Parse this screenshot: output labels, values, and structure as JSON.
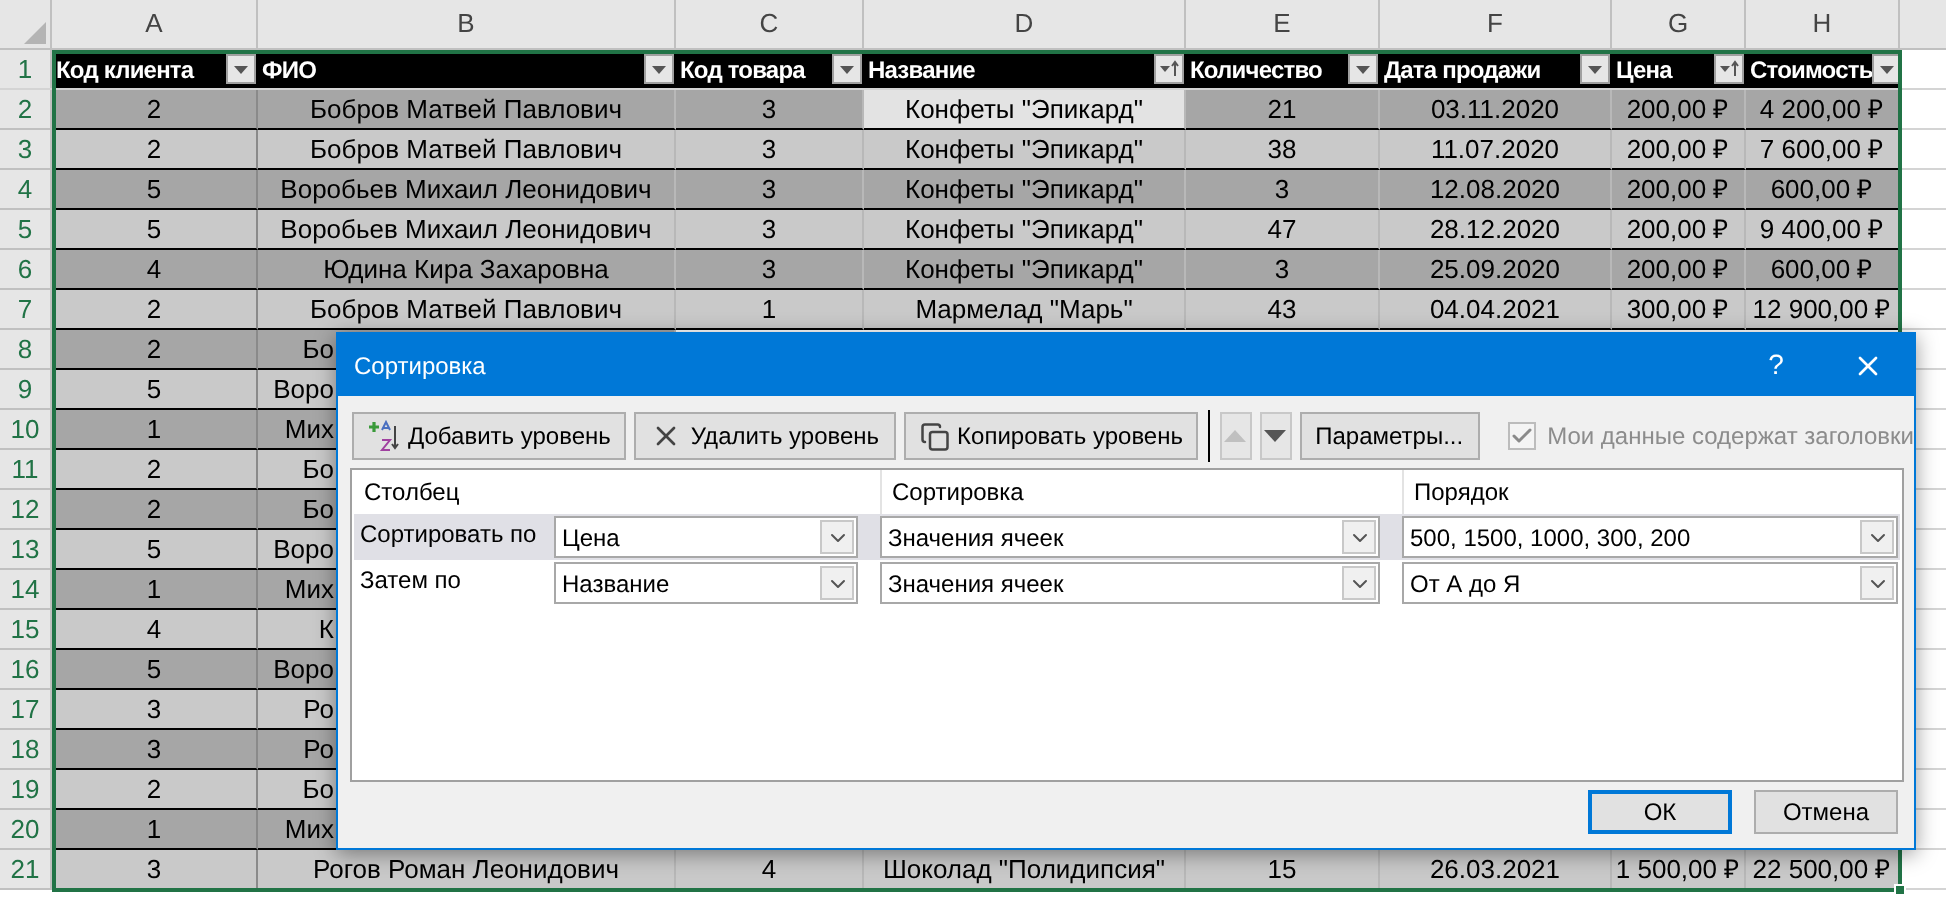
{
  "sheet": {
    "columns": [
      {
        "letter": "A",
        "header": "Код клиента",
        "sorted": false
      },
      {
        "letter": "B",
        "header": "ФИО",
        "sorted": false
      },
      {
        "letter": "C",
        "header": "Код товара",
        "sorted": false
      },
      {
        "letter": "D",
        "header": "Название",
        "sorted": true
      },
      {
        "letter": "E",
        "header": "Количество",
        "sorted": false
      },
      {
        "letter": "F",
        "header": "Дата продажи",
        "sorted": false
      },
      {
        "letter": "G",
        "header": "Цена",
        "sorted": true
      },
      {
        "letter": "H",
        "header": "Стоимость",
        "sorted": false
      }
    ],
    "header_row_number": "1",
    "rows": [
      {
        "number": "2",
        "cells": [
          "2",
          "Бобров Матвей Павлович",
          "3",
          "Конфеты \"Эпикард\"",
          "21",
          "03.11.2020",
          "200,00 ₽",
          "4 200,00 ₽"
        ],
        "selected_cells": [
          false,
          false,
          false,
          true,
          false,
          false,
          false,
          false
        ]
      },
      {
        "number": "3",
        "cells": [
          "2",
          "Бобров Матвей Павлович",
          "3",
          "Конфеты \"Эпикард\"",
          "38",
          "11.07.2020",
          "200,00 ₽",
          "7 600,00 ₽"
        ],
        "selected_cells": [
          false,
          false,
          false,
          false,
          false,
          false,
          false,
          false
        ]
      },
      {
        "number": "4",
        "cells": [
          "5",
          "Воробьев Михаил Леонидович",
          "3",
          "Конфеты \"Эпикард\"",
          "3",
          "12.08.2020",
          "200,00 ₽",
          "600,00 ₽"
        ],
        "selected_cells": [
          false,
          false,
          false,
          false,
          false,
          false,
          false,
          false
        ]
      },
      {
        "number": "5",
        "cells": [
          "5",
          "Воробьев Михаил Леонидович",
          "3",
          "Конфеты \"Эпикард\"",
          "47",
          "28.12.2020",
          "200,00 ₽",
          "9 400,00 ₽"
        ],
        "selected_cells": [
          false,
          false,
          false,
          false,
          false,
          false,
          false,
          false
        ]
      },
      {
        "number": "6",
        "cells": [
          "4",
          "Юдина Кира Захаровна",
          "3",
          "Конфеты \"Эпикард\"",
          "3",
          "25.09.2020",
          "200,00 ₽",
          "600,00 ₽"
        ],
        "selected_cells": [
          false,
          false,
          false,
          false,
          false,
          false,
          false,
          false
        ]
      },
      {
        "number": "7",
        "cells": [
          "2",
          "Бобров Матвей Павлович",
          "1",
          "Мармелад \"Марь\"",
          "43",
          "04.04.2021",
          "300,00 ₽",
          "12 900,00 ₽"
        ],
        "selected_cells": [
          false,
          false,
          false,
          false,
          false,
          false,
          false,
          false
        ]
      },
      {
        "number": "8",
        "cells": [
          "2",
          "Бо"
        ],
        "selected_cells": [
          false,
          false
        ]
      },
      {
        "number": "9",
        "cells": [
          "5",
          "Воро"
        ],
        "selected_cells": [
          false,
          false
        ]
      },
      {
        "number": "10",
        "cells": [
          "1",
          "Мих"
        ],
        "selected_cells": [
          false,
          false
        ]
      },
      {
        "number": "11",
        "cells": [
          "2",
          "Бо"
        ],
        "selected_cells": [
          false,
          false
        ]
      },
      {
        "number": "12",
        "cells": [
          "2",
          "Бо"
        ],
        "selected_cells": [
          false,
          false
        ]
      },
      {
        "number": "13",
        "cells": [
          "5",
          "Воро"
        ],
        "selected_cells": [
          false,
          false
        ]
      },
      {
        "number": "14",
        "cells": [
          "1",
          "Мих"
        ],
        "selected_cells": [
          false,
          false
        ]
      },
      {
        "number": "15",
        "cells": [
          "4",
          "К"
        ],
        "selected_cells": [
          false,
          false
        ]
      },
      {
        "number": "16",
        "cells": [
          "5",
          "Воро"
        ],
        "selected_cells": [
          false,
          false
        ]
      },
      {
        "number": "17",
        "cells": [
          "3",
          "Ро"
        ],
        "selected_cells": [
          false,
          false
        ]
      },
      {
        "number": "18",
        "cells": [
          "3",
          "Ро"
        ],
        "selected_cells": [
          false,
          false
        ]
      },
      {
        "number": "19",
        "cells": [
          "2",
          "Бо"
        ],
        "selected_cells": [
          false,
          false
        ]
      },
      {
        "number": "20",
        "cells": [
          "1",
          "Мих"
        ],
        "selected_cells": [
          false,
          false
        ]
      },
      {
        "number": "21",
        "cells": [
          "3",
          "Рогов Роман Леонидович",
          "4",
          "Шоколад \"Полидипсия\"",
          "15",
          "26.03.2021",
          "1 500,00 ₽",
          "22 500,00 ₽"
        ],
        "selected_cells": [
          false,
          false,
          false,
          false,
          false,
          false,
          false,
          false
        ]
      }
    ]
  },
  "dialog": {
    "title": "Сортировка",
    "help": "?",
    "toolbar": [
      {
        "kind": "add",
        "label": "Добавить уровень",
        "disabled": false
      },
      {
        "kind": "delete",
        "label": "Удалить уровень",
        "disabled": false
      },
      {
        "kind": "copy",
        "label": "Копировать уровень",
        "disabled": false
      },
      {
        "kind": "up",
        "disabled": true
      },
      {
        "kind": "down",
        "disabled": false
      },
      {
        "kind": "text",
        "label": "Параметры...",
        "disabled": false
      }
    ],
    "header_checkbox": {
      "label": "Мои данные содержат заголовки",
      "checked": true,
      "disabled": true
    },
    "grid_headers": [
      "Столбец",
      "Сортировка",
      "Порядок"
    ],
    "levels": [
      {
        "label": "Сортировать по",
        "selected": true,
        "column": "Цена",
        "sort_on": "Значения ячеек",
        "order": "500, 1500, 1000, 300, 200"
      },
      {
        "label": "Затем по",
        "selected": false,
        "column": "Название",
        "sort_on": "Значения ячеек",
        "order": "От А до Я"
      }
    ],
    "buttons": [
      {
        "label": "ОК",
        "default": true
      },
      {
        "label": "Отмена",
        "default": false
      }
    ]
  }
}
